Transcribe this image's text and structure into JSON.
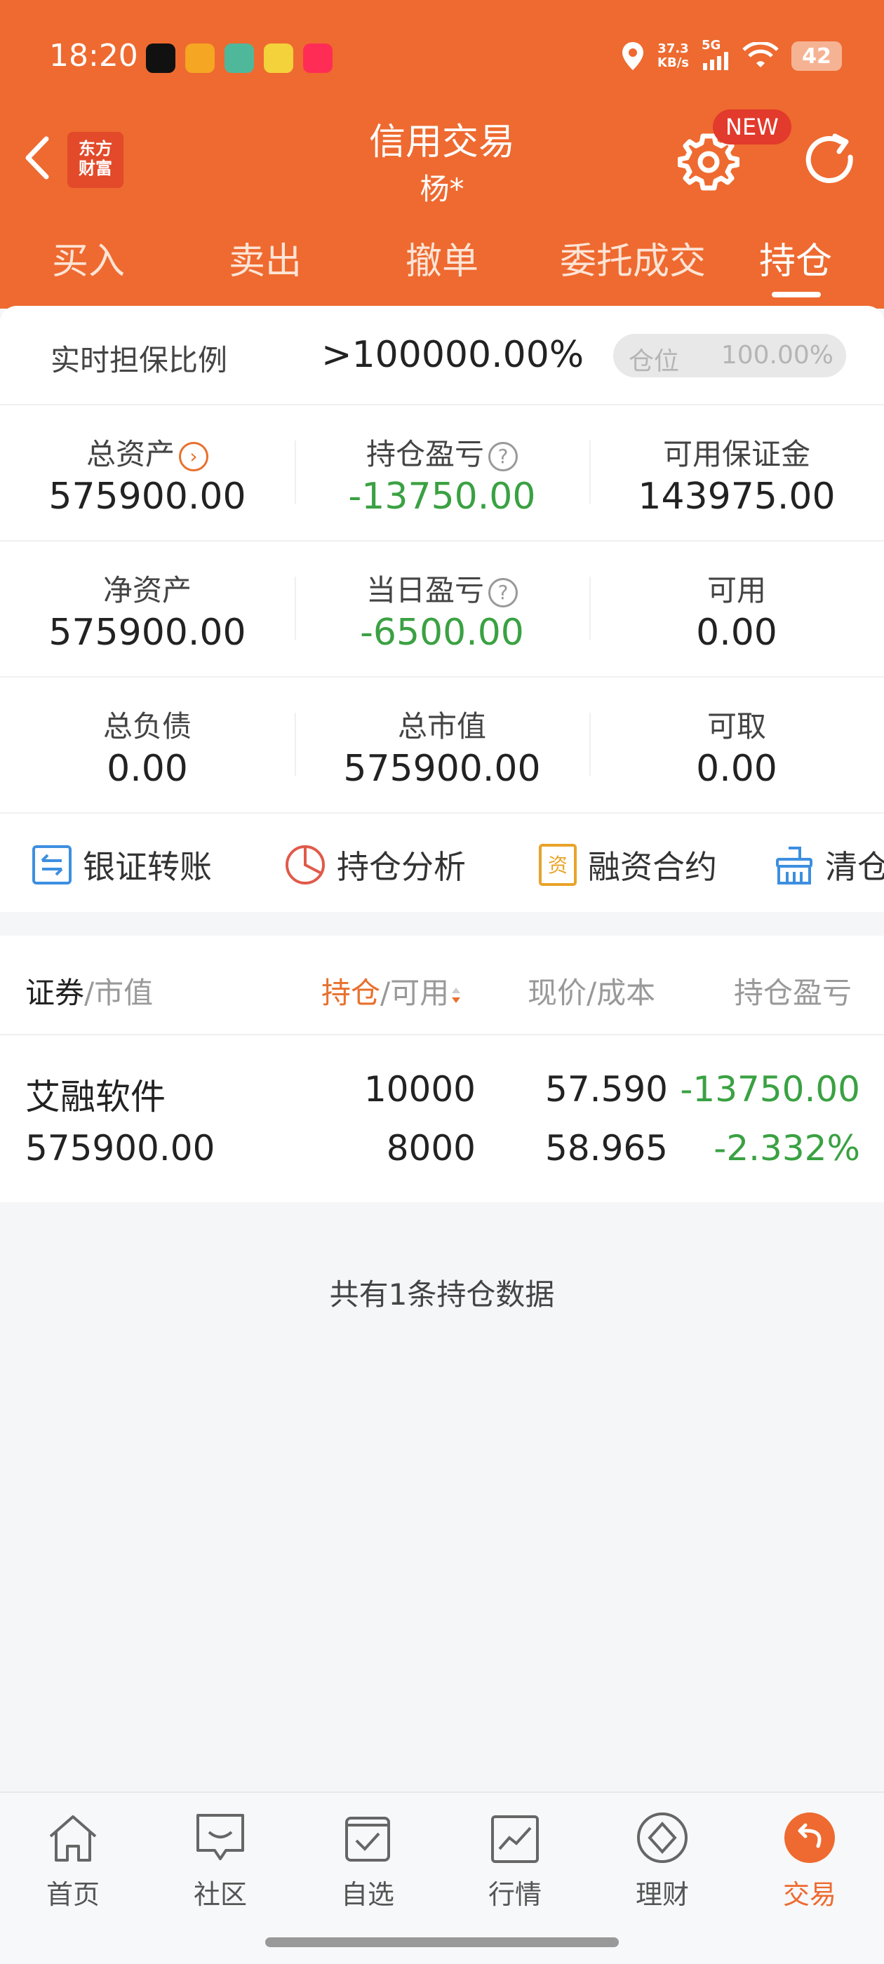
{
  "status_bar": {
    "time": "18:20",
    "net_speed_value": "37.3",
    "net_speed_unit": "KB/s",
    "network": "5G",
    "battery": "42",
    "apps": [
      "tiktok-icon",
      "video-app-icon",
      "chat-app-icon",
      "fruit-app-icon",
      "red-note-icon"
    ]
  },
  "header": {
    "logo_line1": "东方",
    "logo_line2": "财富",
    "title": "信用交易",
    "subtitle": "杨*",
    "new_badge": "NEW"
  },
  "tabs": [
    {
      "label": "买入"
    },
    {
      "label": "卖出"
    },
    {
      "label": "撤单"
    },
    {
      "label": "委托成交"
    },
    {
      "label": "持仓",
      "active": true
    }
  ],
  "ratio": {
    "label": "实时担保比例",
    "value": ">100000.00%",
    "position_label": "仓位",
    "position_value": "100.00%"
  },
  "summary_grid": [
    [
      {
        "label": "总资产",
        "value": "575900.00"
      },
      {
        "label": "持仓盈亏",
        "value": "-13750.00"
      },
      {
        "label": "可用保证金",
        "value": "143975.00"
      }
    ],
    [
      {
        "label": "净资产",
        "value": "575900.00"
      },
      {
        "label": "当日盈亏",
        "value": "-6500.00"
      },
      {
        "label": "可用",
        "value": "0.00"
      }
    ],
    [
      {
        "label": "总负债",
        "value": "0.00"
      },
      {
        "label": "总市值",
        "value": "575900.00"
      },
      {
        "label": "可取",
        "value": "0.00"
      }
    ]
  ],
  "tools": [
    {
      "label": "银证转账"
    },
    {
      "label": "持仓分析"
    },
    {
      "label": "融资合约"
    },
    {
      "label": "清仓"
    }
  ],
  "table_head": {
    "col1_a": "证券",
    "col1_b": "/市值",
    "col2_a": "持仓",
    "col2_b": "/可用",
    "col3": "现价/成本",
    "col4": "持仓盈亏"
  },
  "holdings": [
    {
      "name": "艾融软件",
      "market_value": "575900.00",
      "position": "10000",
      "available": "8000",
      "price": "57.590",
      "cost": "58.965",
      "pnl": "-13750.00",
      "pnl_pct": "-2.332%"
    }
  ],
  "summary_text": "共有1条持仓数据",
  "bottom_nav": [
    {
      "label": "首页"
    },
    {
      "label": "社区"
    },
    {
      "label": "自选"
    },
    {
      "label": "行情"
    },
    {
      "label": "理财"
    },
    {
      "label": "交易",
      "active": true
    }
  ],
  "colors": {
    "brand": "#ee6a30",
    "loss": "#3aa142",
    "badge": "#e23a2c"
  }
}
